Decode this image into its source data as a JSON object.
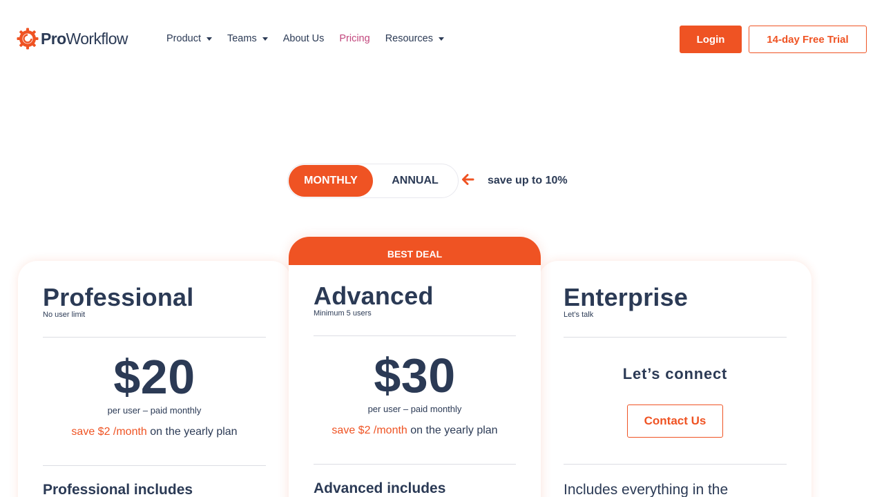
{
  "brand": {
    "logo_bold": "Pro",
    "logo_rest": "Workflow",
    "accent": "#ef5323",
    "text": "#2b3a55",
    "nav_active": "#c2477d"
  },
  "nav": {
    "items": [
      {
        "label": "Product",
        "has_caret": true
      },
      {
        "label": "Teams",
        "has_caret": true
      },
      {
        "label": "About Us",
        "has_caret": false
      },
      {
        "label": "Pricing",
        "has_caret": false,
        "active": true
      },
      {
        "label": "Resources",
        "has_caret": true
      }
    ],
    "login_label": "Login",
    "trial_label": "14-day Free Trial"
  },
  "billing": {
    "monthly_label": "MONTHLY",
    "annual_label": "ANNUAL",
    "selected": "MONTHLY",
    "save_text": "save up to 10%"
  },
  "plans": {
    "professional": {
      "name": "Professional",
      "subtitle": "No user limit",
      "price": "$20",
      "price_note": "per user – paid monthly",
      "save_highlight": "save $2 /month",
      "save_rest": " on the yearly plan",
      "includes_title": "Professional includes"
    },
    "advanced": {
      "ribbon": "BEST DEAL",
      "name": "Advanced",
      "subtitle": "Minimum 5 users",
      "price": "$30",
      "price_note": "per user – paid monthly",
      "save_highlight": "save $2 /month",
      "save_rest": " on the yearly plan",
      "includes_title": "Advanced includes"
    },
    "enterprise": {
      "name": "Enterprise",
      "subtitle": "Let’s talk",
      "connect": "Let’s connect",
      "contact_label": "Contact Us",
      "includes_text": "Includes everything in the"
    }
  }
}
